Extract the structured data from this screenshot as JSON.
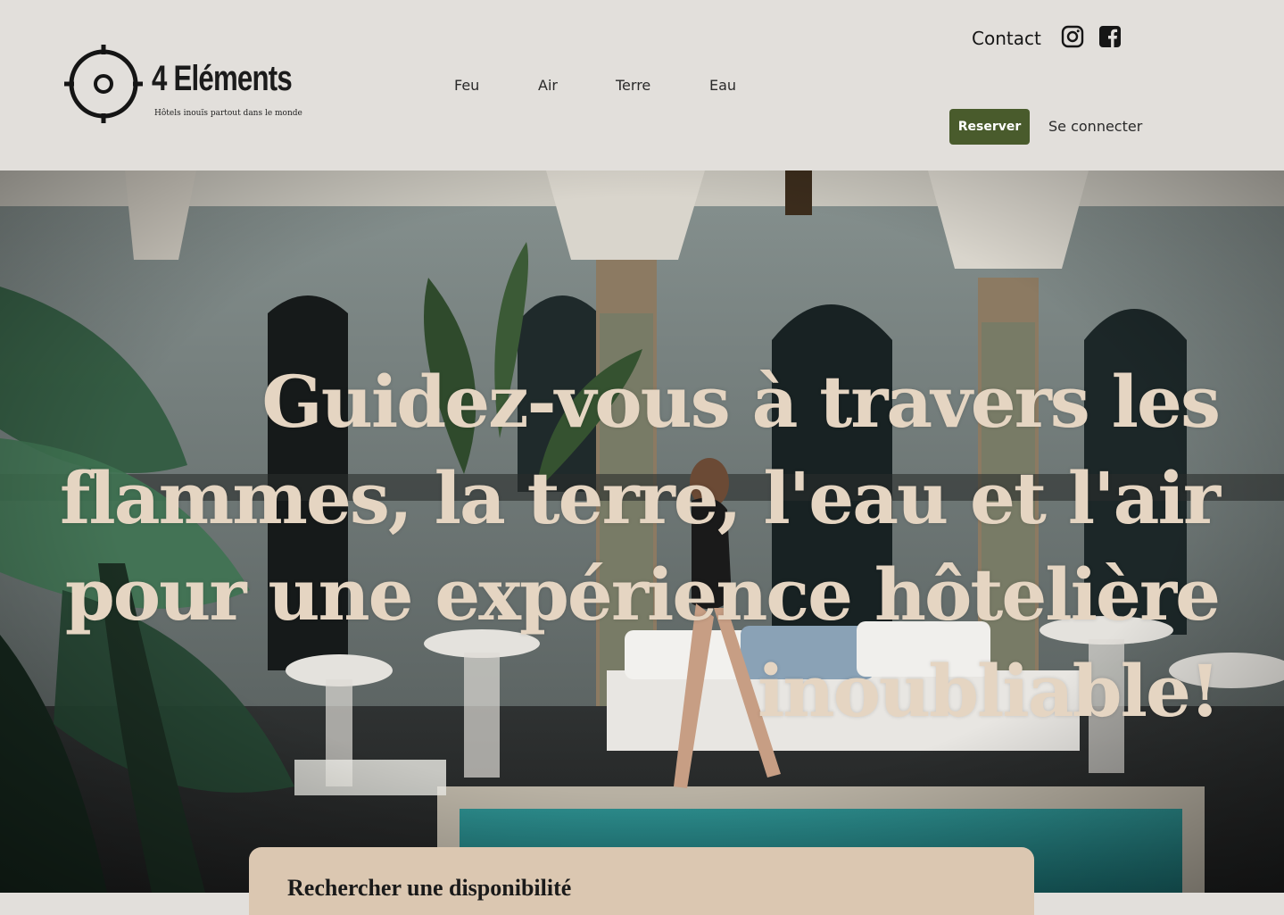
{
  "brand": {
    "name": "4 Eléments",
    "tagline": "Hôtels inouïs partout dans le monde"
  },
  "nav": {
    "items": [
      {
        "label": "Feu"
      },
      {
        "label": "Air"
      },
      {
        "label": "Terre"
      },
      {
        "label": "Eau"
      }
    ]
  },
  "header_actions": {
    "contact_label": "Contact",
    "instagram_icon": "instagram-icon",
    "facebook_icon": "facebook-icon",
    "reserve_label": "Reserver",
    "login_label": "Se connecter"
  },
  "hero": {
    "headline": "Guidez-vous à travers les flammes, la terre, l'eau et l'air pour une expérience hôtelière inoubliable!"
  },
  "search": {
    "title": "Rechercher une disponibilité"
  },
  "colors": {
    "page_bg": "#e2dfdb",
    "accent_green": "#495b2c",
    "headline_cream": "#e5d5c2",
    "card_beige": "#dbc7b1"
  }
}
